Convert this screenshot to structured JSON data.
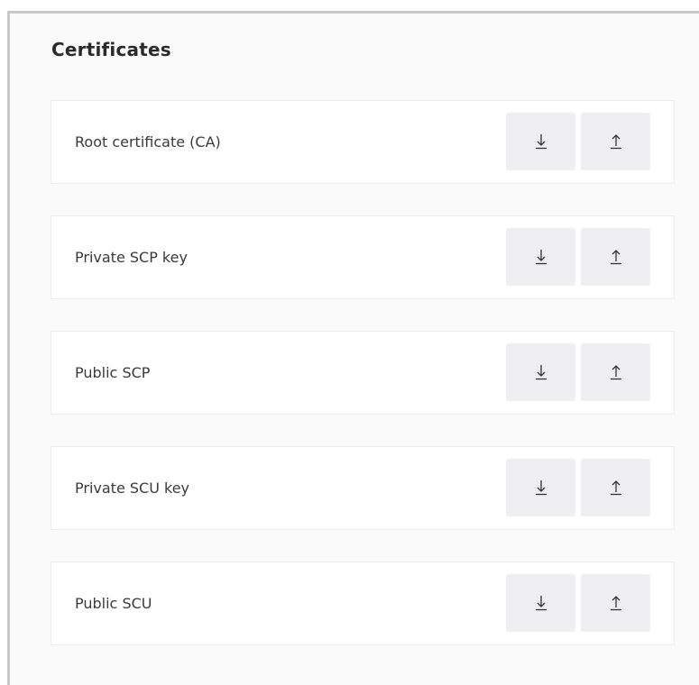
{
  "panel": {
    "title": "Certificates"
  },
  "certificates": [
    {
      "label": "Root certificate (CA)",
      "download_icon": "download-icon",
      "upload_icon": "upload-icon"
    },
    {
      "label": "Private SCP key",
      "download_icon": "download-icon",
      "upload_icon": "upload-icon"
    },
    {
      "label": "Public SCP",
      "download_icon": "download-icon",
      "upload_icon": "upload-icon"
    },
    {
      "label": "Private SCU key",
      "download_icon": "download-icon",
      "upload_icon": "upload-icon"
    },
    {
      "label": "Public SCU",
      "download_icon": "download-icon",
      "upload_icon": "upload-icon"
    }
  ],
  "colors": {
    "panel_background": "#fafafa",
    "row_background": "#ffffff",
    "button_background": "#efeef0",
    "text": "#3a3a3a",
    "title": "#2b2b2b"
  }
}
